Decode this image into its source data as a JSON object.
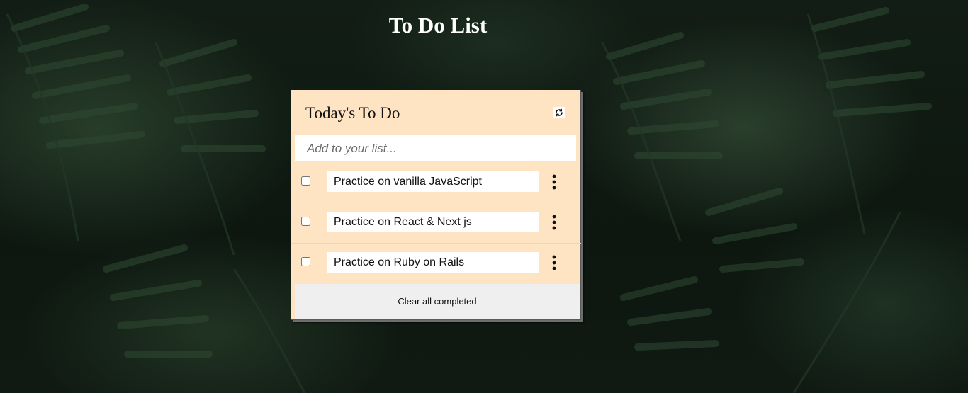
{
  "page": {
    "title": "To Do List"
  },
  "card": {
    "heading": "Today's To Do",
    "refresh_icon": "refresh-icon",
    "input": {
      "placeholder": "Add to your list...",
      "value": ""
    },
    "tasks": [
      {
        "text": "Practice on vanilla JavaScript",
        "completed": false
      },
      {
        "text": "Practice on React & Next js",
        "completed": false
      },
      {
        "text": "Practice on Ruby on Rails",
        "completed": false
      }
    ],
    "task_menu_icon": "vertical-ellipsis-icon",
    "clear_label": "Clear all completed"
  },
  "colors": {
    "card_background": "#ffe4c4",
    "clear_bar_background": "#efefef",
    "title_color": "#ffffff"
  }
}
